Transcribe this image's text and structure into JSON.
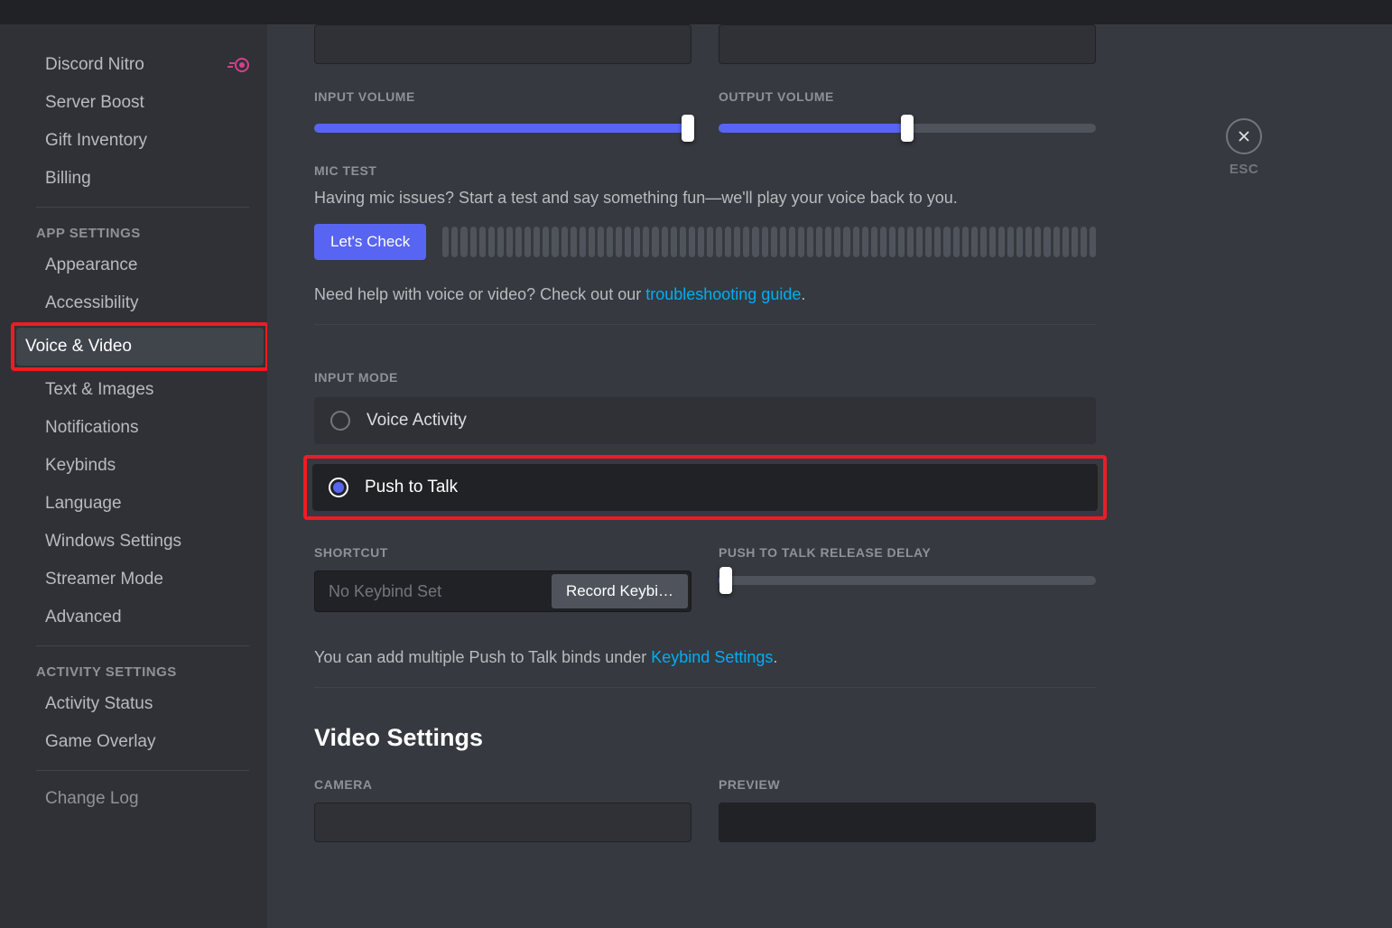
{
  "sidebar": {
    "billing_items": [
      "Discord Nitro",
      "Server Boost",
      "Gift Inventory",
      "Billing"
    ],
    "app_header": "APP SETTINGS",
    "app_items": [
      "Appearance",
      "Accessibility",
      "Voice & Video",
      "Text & Images",
      "Notifications",
      "Keybinds",
      "Language",
      "Windows Settings",
      "Streamer Mode",
      "Advanced"
    ],
    "activity_header": "ACTIVITY SETTINGS",
    "activity_items": [
      "Activity Status",
      "Game Overlay"
    ],
    "changelog": "Change Log"
  },
  "close_label": "ESC",
  "volume": {
    "input_label": "INPUT VOLUME",
    "output_label": "OUTPUT VOLUME",
    "input_percent": 100,
    "output_percent": 50
  },
  "mic_test": {
    "label": "MIC TEST",
    "desc": "Having mic issues? Start a test and say something fun—we'll play your voice back to you.",
    "button": "Let's Check"
  },
  "help": {
    "prefix": "Need help with voice or video? Check out our ",
    "link": "troubleshooting guide",
    "suffix": "."
  },
  "input_mode": {
    "label": "INPUT MODE",
    "opt_voice": "Voice Activity",
    "opt_ptt": "Push to Talk"
  },
  "shortcut": {
    "label": "SHORTCUT",
    "placeholder": "No Keybind Set",
    "button": "Record Keybi…"
  },
  "ptt_delay": {
    "label": "PUSH TO TALK RELEASE DELAY",
    "percent": 1
  },
  "keybind_hint": {
    "prefix": "You can add multiple Push to Talk binds under ",
    "link": "Keybind Settings",
    "suffix": "."
  },
  "video": {
    "title": "Video Settings",
    "camera_label": "CAMERA",
    "preview_label": "PREVIEW"
  }
}
